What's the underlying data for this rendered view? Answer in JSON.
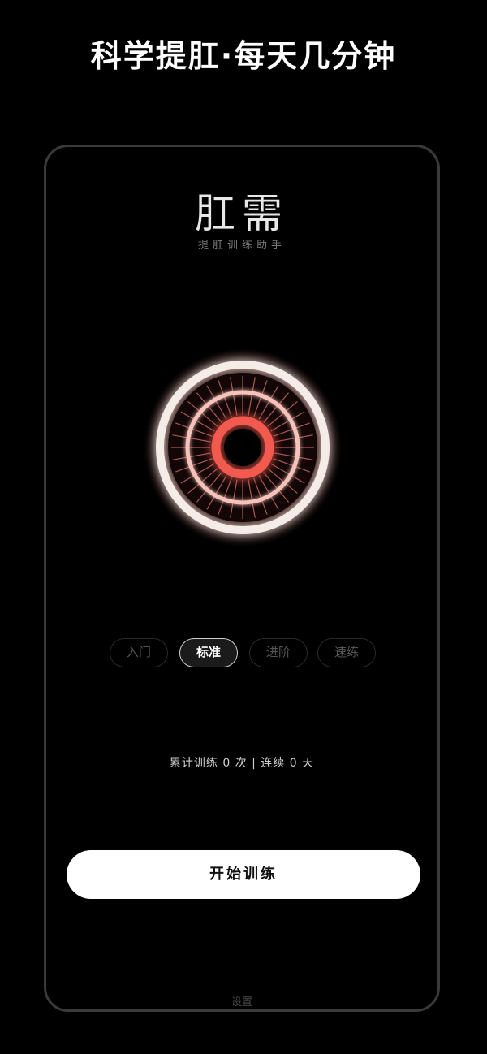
{
  "promo": {
    "headline": "科学提肛·每天几分钟"
  },
  "app": {
    "title": "肛需",
    "subtitle": "提肛训练助手"
  },
  "modes": {
    "items": [
      {
        "label": "入门",
        "active": false
      },
      {
        "label": "标准",
        "active": true
      },
      {
        "label": "进阶",
        "active": false
      },
      {
        "label": "速练",
        "active": false
      }
    ]
  },
  "stats": {
    "text": "累计训练 0 次 | 连续 0 天"
  },
  "actions": {
    "start_label": "开始训练",
    "settings_label": "设置"
  },
  "colors": {
    "ring_outer": "#f2e9e4",
    "ring_mid": "#f4b1a8",
    "ring_inner": "#f0584f",
    "glow": "#ff6a5a",
    "background": "#000000",
    "button": "#ffffff"
  }
}
